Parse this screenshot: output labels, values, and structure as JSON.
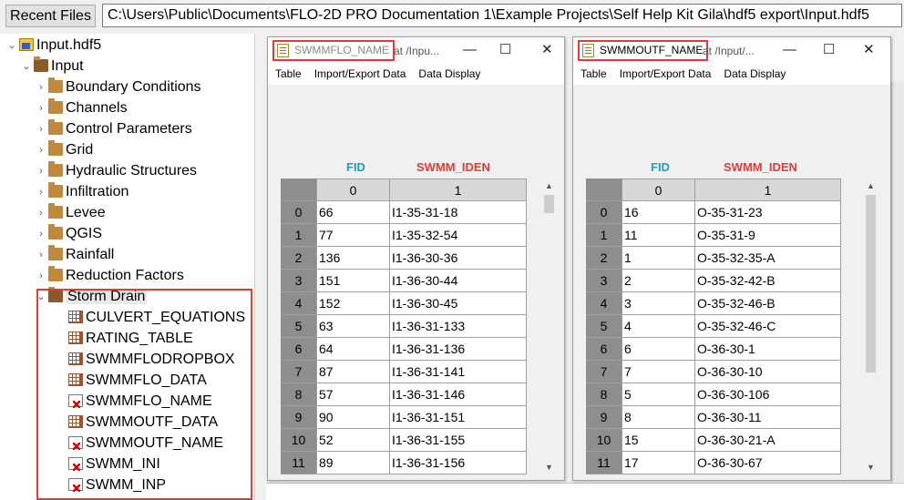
{
  "toolbar": {
    "recent_files_label": "Recent Files",
    "path": "C:\\Users\\Public\\Documents\\FLO-2D PRO Documentation 1\\Example Projects\\Self Help Kit Gila\\hdf5 export\\Input.hdf5"
  },
  "tree": {
    "root": "Input.hdf5",
    "input_group": "Input",
    "groups": [
      "Boundary Conditions",
      "Channels",
      "Control Parameters",
      "Grid",
      "Hydraulic Structures",
      "Infiltration",
      "Levee",
      "QGIS",
      "Rainfall",
      "Reduction Factors"
    ],
    "storm_drain": "Storm Drain",
    "storm_drain_items": [
      {
        "label": "CULVERT_EQUATIONS",
        "icon": "table-icon"
      },
      {
        "label": "RATING_TABLE",
        "icon": "table-icon"
      },
      {
        "label": "SWMMFLODROPBOX",
        "icon": "table-icon"
      },
      {
        "label": "SWMMFLO_DATA",
        "icon": "table-icon"
      },
      {
        "label": "SWMMFLO_NAME",
        "icon": "string-dataset-icon"
      },
      {
        "label": "SWMMOUTF_DATA",
        "icon": "table-icon"
      },
      {
        "label": "SWMMOUTF_NAME",
        "icon": "string-dataset-icon"
      },
      {
        "label": "SWMM_INI",
        "icon": "string-dataset-icon"
      },
      {
        "label": "SWMM_INP",
        "icon": "string-dataset-icon"
      }
    ]
  },
  "window1": {
    "title": "SWMMFLO_NAME",
    "title_suffix": "at  /Inpu...",
    "menu": [
      "Table",
      "Import/Export Data",
      "Data Display"
    ],
    "header_fid": "FID",
    "header_iden": "SWMM_IDEN",
    "col_headers": [
      "0",
      "1"
    ],
    "rows": [
      {
        "idx": "0",
        "fid": "66",
        "iden": "I1-35-31-18"
      },
      {
        "idx": "1",
        "fid": "77",
        "iden": "I1-35-32-54"
      },
      {
        "idx": "2",
        "fid": "136",
        "iden": "I1-36-30-36"
      },
      {
        "idx": "3",
        "fid": "151",
        "iden": "I1-36-30-44"
      },
      {
        "idx": "4",
        "fid": "152",
        "iden": "I1-36-30-45"
      },
      {
        "idx": "5",
        "fid": "63",
        "iden": "I1-36-31-133"
      },
      {
        "idx": "6",
        "fid": "64",
        "iden": "I1-36-31-136"
      },
      {
        "idx": "7",
        "fid": "87",
        "iden": "I1-36-31-141"
      },
      {
        "idx": "8",
        "fid": "57",
        "iden": "I1-36-31-146"
      },
      {
        "idx": "9",
        "fid": "90",
        "iden": "I1-36-31-151"
      },
      {
        "idx": "10",
        "fid": "52",
        "iden": "I1-36-31-155"
      },
      {
        "idx": "11",
        "fid": "89",
        "iden": "I1-36-31-156"
      }
    ]
  },
  "window2": {
    "title": "SWMMOUTF_NAME",
    "title_suffix": "at  /Input/...",
    "menu": [
      "Table",
      "Import/Export Data",
      "Data Display"
    ],
    "header_fid": "FID",
    "header_iden": "SWMM_IDEN",
    "col_headers": [
      "0",
      "1"
    ],
    "rows": [
      {
        "idx": "0",
        "fid": "16",
        "iden": "O-35-31-23"
      },
      {
        "idx": "1",
        "fid": "11",
        "iden": "O-35-31-9"
      },
      {
        "idx": "2",
        "fid": "1",
        "iden": "O-35-32-35-A"
      },
      {
        "idx": "3",
        "fid": "2",
        "iden": "O-35-32-42-B"
      },
      {
        "idx": "4",
        "fid": "3",
        "iden": "O-35-32-46-B"
      },
      {
        "idx": "5",
        "fid": "4",
        "iden": "O-35-32-46-C"
      },
      {
        "idx": "6",
        "fid": "6",
        "iden": "O-36-30-1"
      },
      {
        "idx": "7",
        "fid": "7",
        "iden": "O-36-30-10"
      },
      {
        "idx": "8",
        "fid": "5",
        "iden": "O-36-30-106"
      },
      {
        "idx": "9",
        "fid": "8",
        "iden": "O-36-30-11"
      },
      {
        "idx": "10",
        "fid": "15",
        "iden": "O-36-30-21-A"
      },
      {
        "idx": "11",
        "fid": "17",
        "iden": "O-36-30-67"
      }
    ]
  },
  "colors": {
    "highlight_border": "#e53935",
    "fid_header": "#17a2b8",
    "iden_header": "#e53935"
  }
}
